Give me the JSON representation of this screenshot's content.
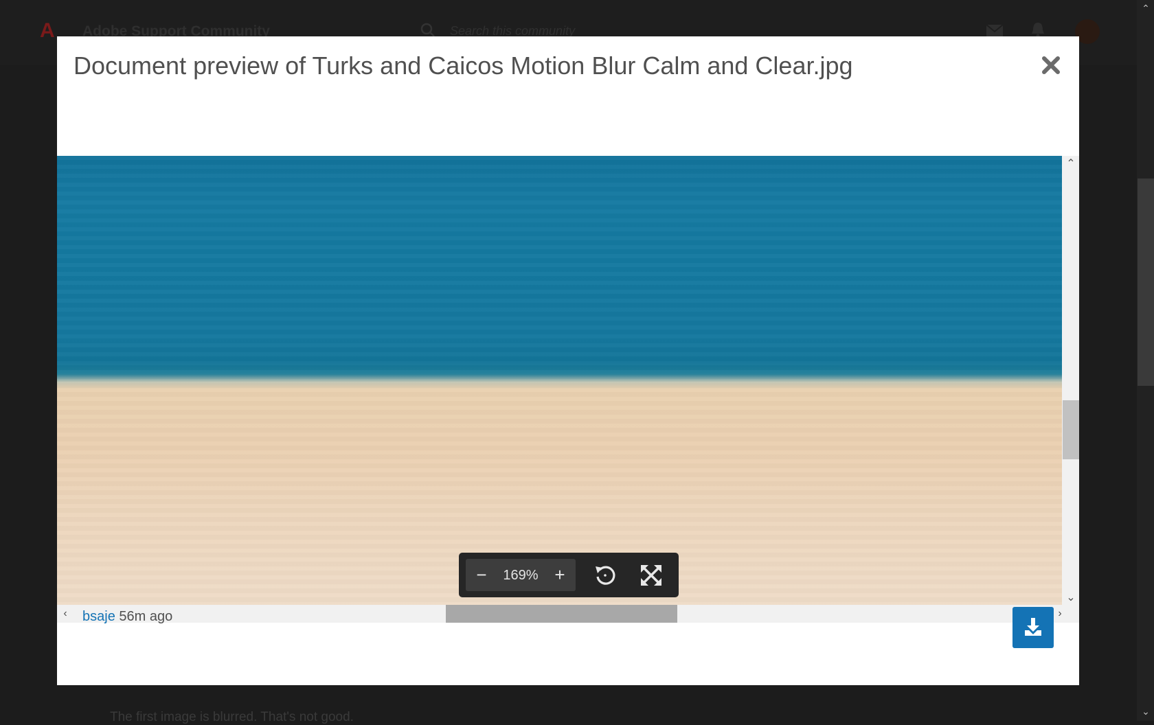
{
  "background": {
    "site_title": "Adobe Support Community",
    "search_placeholder": "Search this community",
    "body_text": "The first image is blurred.  That's not good."
  },
  "modal": {
    "title": "Document preview of Turks and Caicos Motion Blur Calm and Clear.jpg",
    "zoom_out_label": "−",
    "zoom_level": "169%",
    "zoom_in_label": "+",
    "author": "bsaje",
    "timestamp": "56m ago",
    "icons": [
      "close-icon",
      "rotate-icon",
      "fullscreen-icon",
      "download-icon"
    ]
  },
  "colors": {
    "accent": "#1473b5",
    "overlay": "#1c1c1c",
    "toolbar": "#262626"
  }
}
